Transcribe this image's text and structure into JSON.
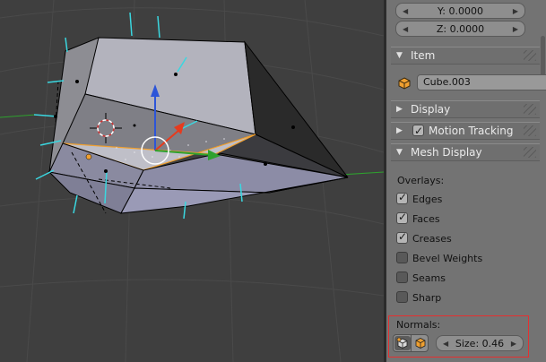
{
  "transform": {
    "y_field": "Y: 0.0000",
    "z_field": "Z: 0.0000"
  },
  "item_panel": {
    "title": "Item",
    "object_name": "Cube.003"
  },
  "display_panel": {
    "title": "Display"
  },
  "motion_tracking_panel": {
    "title": "Motion Tracking",
    "enabled": true
  },
  "mesh_display_panel": {
    "title": "Mesh Display",
    "overlays_label": "Overlays:",
    "overlays": [
      {
        "label": "Edges",
        "checked": true
      },
      {
        "label": "Faces",
        "checked": true
      },
      {
        "label": "Creases",
        "checked": true
      },
      {
        "label": "Bevel Weights",
        "checked": false
      },
      {
        "label": "Seams",
        "checked": false
      },
      {
        "label": "Sharp",
        "checked": false
      }
    ],
    "normals_label": "Normals:",
    "normals_size": "Size: 0.46"
  },
  "colors": {
    "panel_bg": "#737373",
    "highlight_box": "#e53030",
    "selection_orange": "#f0a030",
    "axis_x": "#e63b1e",
    "axis_y": "#2ea12e",
    "axis_z": "#2d55d8",
    "normals_cyan": "#3ad7e0"
  }
}
